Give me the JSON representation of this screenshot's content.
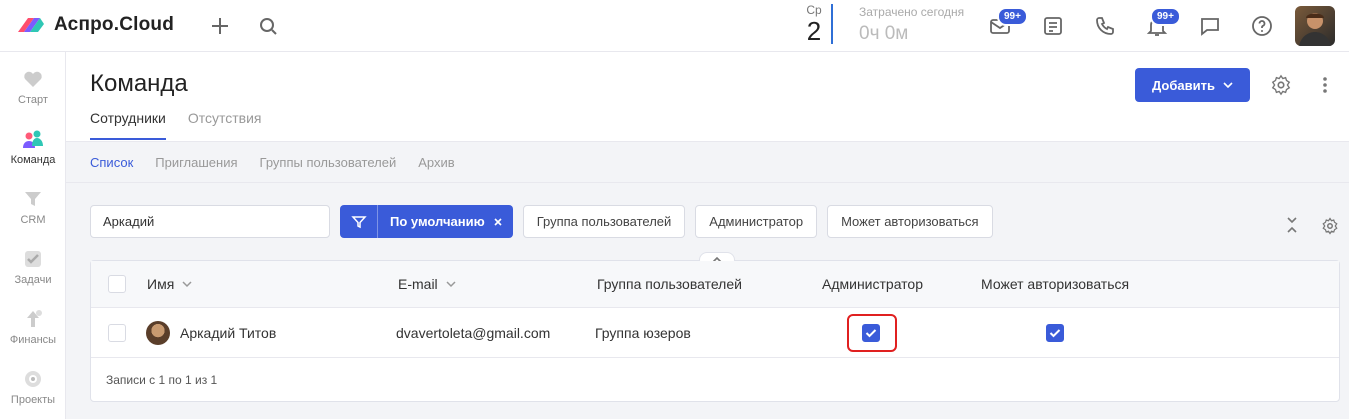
{
  "app": {
    "brand": "Аспро.Cloud",
    "day_of_week": "Ср",
    "day_number": "2",
    "spent_label": "Затрачено сегодня",
    "spent_value": "0ч 0м",
    "mail_badge": "99+",
    "notif_badge": "99+",
    "accent_color": "#3a5bd9"
  },
  "sidebar": {
    "items": [
      {
        "label": "Старт",
        "icon": "heart-icon"
      },
      {
        "label": "Команда",
        "icon": "team-icon"
      },
      {
        "label": "CRM",
        "icon": "funnel-icon"
      },
      {
        "label": "Задачи",
        "icon": "check-icon"
      },
      {
        "label": "Финансы",
        "icon": "finance-icon"
      },
      {
        "label": "Проекты",
        "icon": "projects-icon"
      }
    ]
  },
  "page": {
    "title": "Команда",
    "tabs": [
      "Сотрудники",
      "Отсутствия"
    ],
    "add_button": "Добавить",
    "subnav": [
      "Список",
      "Приглашения",
      "Группы пользователей",
      "Архив"
    ]
  },
  "filters": {
    "search_value": "Аркадий",
    "preset": "По умолчанию",
    "chips": [
      "Группа пользователей",
      "Администратор",
      "Может авторизоваться"
    ]
  },
  "table": {
    "columns": [
      "Имя",
      "E-mail",
      "Группа пользователей",
      "Администратор",
      "Может авторизоваться"
    ],
    "rows": [
      {
        "name": "Аркадий Титов",
        "email": "dvavertoleta@gmail.com",
        "group": "Группа юзеров",
        "admin": true,
        "can_login": true
      }
    ],
    "footer": "Записи с 1 по 1 из 1"
  }
}
